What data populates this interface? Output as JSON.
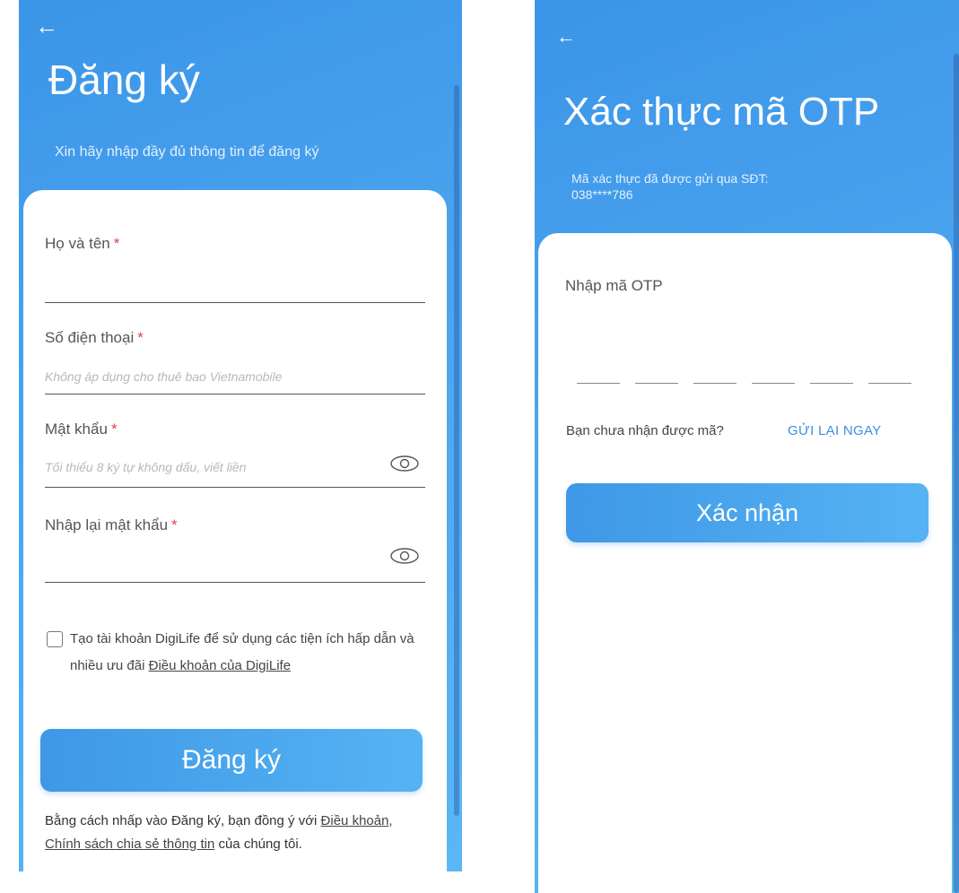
{
  "register": {
    "title": "Đăng ký",
    "subtitle": "Xin hãy nhập đầy đủ thông tin để đăng ký",
    "fields": [
      {
        "label": "Họ và tên",
        "required_mark": "*",
        "placeholder": ""
      },
      {
        "label": "Số điện thoại",
        "required_mark": "*",
        "placeholder": "Không áp dụng cho thuê bao Vietnamobile"
      },
      {
        "label": "Mật khẩu",
        "required_mark": "*",
        "placeholder": "Tối thiểu 8 ký tự không dấu, viết liền"
      },
      {
        "label": "Nhập lại mật khẩu",
        "required_mark": "*",
        "placeholder": ""
      }
    ],
    "consent_text": "Tạo tài khoản DigiLife để sử dụng các tiện ích hấp dẫn và nhiều ưu đãi",
    "consent_link": "Điều khoản của DigiLife",
    "consent_checked": false,
    "submit_label": "Đăng ký",
    "footnote_prefix": "Bằng cách nhấp vào Đăng ký, bạn đồng ý với",
    "footnote_link": "Điều khoản, Chính sách chia sẻ thông tin",
    "footnote_suffix": "của chúng tôi.",
    "icons": {
      "back": "arrow-left-icon",
      "password_toggle": "eye-icon"
    }
  },
  "otp": {
    "title": "Xác thực mã OTP",
    "subtitle_line1": "Mã xác thực đã được gửi qua SĐT:",
    "subtitle_line2": "038****786",
    "input_label": "Nhập mã OTP",
    "digits": 6,
    "resend_question": "Bạn chưa nhận được mã?",
    "resend_action": "GỬI LẠI NGAY",
    "confirm_label": "Xác nhận"
  },
  "colors": {
    "header_gradient_start": "#3b95e8",
    "header_gradient_end": "#5ab8f6",
    "required": "#e0424b",
    "link_accent": "#3a8fdc"
  }
}
